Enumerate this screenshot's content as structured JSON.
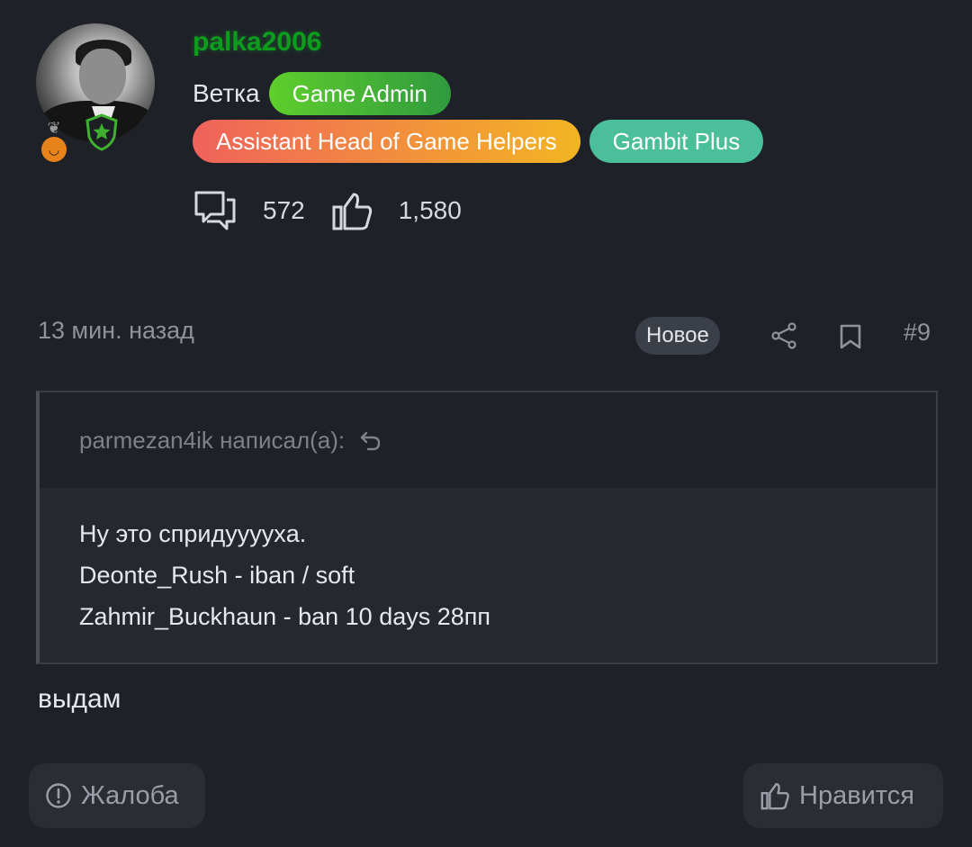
{
  "user": {
    "username": "palka2006",
    "branch": "Ветка",
    "roles": [
      "Game Admin",
      "Assistant Head of Game Helpers",
      "Gambit Plus"
    ],
    "role_colors": {
      "game_admin": "#4fbf33",
      "helpers_start": "#f0625c",
      "helpers_end": "#f3b523",
      "gambit": "#4bbf9a",
      "username": "#0d9c1c"
    },
    "messages_count": "572",
    "likes_count": "1,580"
  },
  "post": {
    "time": "13 мин. назад",
    "new_label": "Новое",
    "number": "#9",
    "quote": {
      "author_line": "parmezan4ik написал(а):",
      "lines": [
        "Ну это спридуууухa.",
        "Deonte_Rush - iban / soft",
        "Zahmir_Buckhaun - ban 10 days 28пп"
      ]
    },
    "reply_text": "выдам"
  },
  "actions": {
    "report_label": "Жалоба",
    "like_label": "Нравится"
  }
}
